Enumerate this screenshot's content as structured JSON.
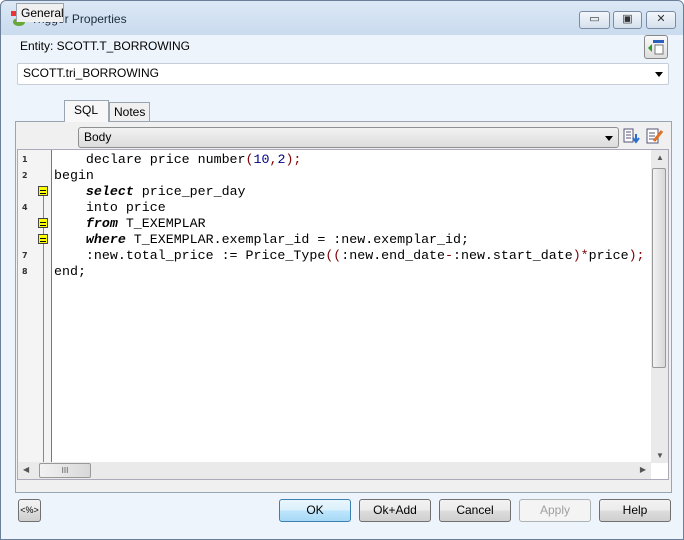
{
  "window": {
    "title": "Trigger Properties",
    "minimize": "▭",
    "maximize": "▣",
    "close": "✕"
  },
  "entity_label": "Entity: SCOTT.T_BORROWING",
  "trigger_select": {
    "value": "SCOTT.tri_BORROWING"
  },
  "tabs": [
    {
      "label": "General"
    },
    {
      "label": "SQL",
      "selected": true
    },
    {
      "label": "Notes"
    }
  ],
  "section_select": {
    "value": "Body"
  },
  "editor": {
    "line_numbers": [
      "1",
      "2",
      "",
      "4",
      "",
      "",
      "7",
      "8"
    ],
    "fold_markers_on_lines": [
      3,
      5,
      6
    ],
    "lines": [
      [
        {
          "t": "    declare price number"
        },
        {
          "t": "(",
          "c": "sym"
        },
        {
          "t": "10",
          "c": "num"
        },
        {
          "t": ",",
          "c": "sym"
        },
        {
          "t": "2",
          "c": "num"
        },
        {
          "t": ");",
          "c": "sym"
        }
      ],
      [
        {
          "t": "begin"
        }
      ],
      [
        {
          "t": "    "
        },
        {
          "t": "select",
          "c": "kw"
        },
        {
          "t": " price_per_day"
        }
      ],
      [
        {
          "t": "    into price"
        }
      ],
      [
        {
          "t": "    "
        },
        {
          "t": "from",
          "c": "kw"
        },
        {
          "t": " T_EXEMPLAR"
        }
      ],
      [
        {
          "t": "    "
        },
        {
          "t": "where",
          "c": "kw"
        },
        {
          "t": " T_EXEMPLAR.exemplar_id = :new.exemplar_id;"
        }
      ],
      [
        {
          "t": "    :new.total_price := Price_Type"
        },
        {
          "t": "((",
          "c": "sym"
        },
        {
          "t": ":new.end_date"
        },
        {
          "t": "-",
          "c": "sym"
        },
        {
          "t": ":new.start_date"
        },
        {
          "t": ")*",
          "c": "sym"
        },
        {
          "t": "price"
        },
        {
          "t": ");",
          "c": "sym"
        }
      ],
      [
        {
          "t": "end;"
        }
      ]
    ]
  },
  "hscroll_grip": "III",
  "buttons": {
    "template": "<%>",
    "ok": "OK",
    "ok_add": "Ok+Add",
    "cancel": "Cancel",
    "apply": "Apply",
    "help": "Help"
  }
}
